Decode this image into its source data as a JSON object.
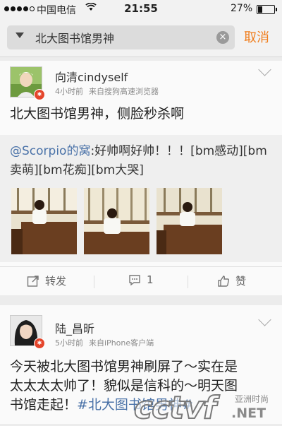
{
  "status_bar": {
    "carrier": "中国电信",
    "time": "21:55",
    "battery": "27%",
    "battery_level": 0.27
  },
  "search": {
    "query": "北大图书馆男神",
    "cancel_label": "取消"
  },
  "posts": [
    {
      "username": "向清cindyself",
      "time": "4小时前",
      "source": "来自搜狗高速浏览器",
      "text": "北大图书馆男神，侧脸秒杀啊",
      "repost": {
        "mention": "@Scorpio的窝",
        "text": ":好帅啊好帅！！！[bm感动][bm卖萌][bm花痴][bm大哭]"
      },
      "actions": {
        "repost_label": "转发",
        "comment_count": "1",
        "like_label": "赞"
      }
    },
    {
      "username": "陆_昌昕",
      "time": "5小时前",
      "source": "来自iPhone客户端",
      "text_line1": "今天被北大图书馆男神刷屏了～实在是",
      "text_line2": "太太太太帅了！貌似是信科的～明天图",
      "text_line3_plain": "书馆走起！",
      "text_line3_topic": "#北大图书馆男神#"
    }
  ],
  "watermark": {
    "logo": "cctvf",
    "tagline": "亚洲时尚",
    "domain": ".NET"
  }
}
